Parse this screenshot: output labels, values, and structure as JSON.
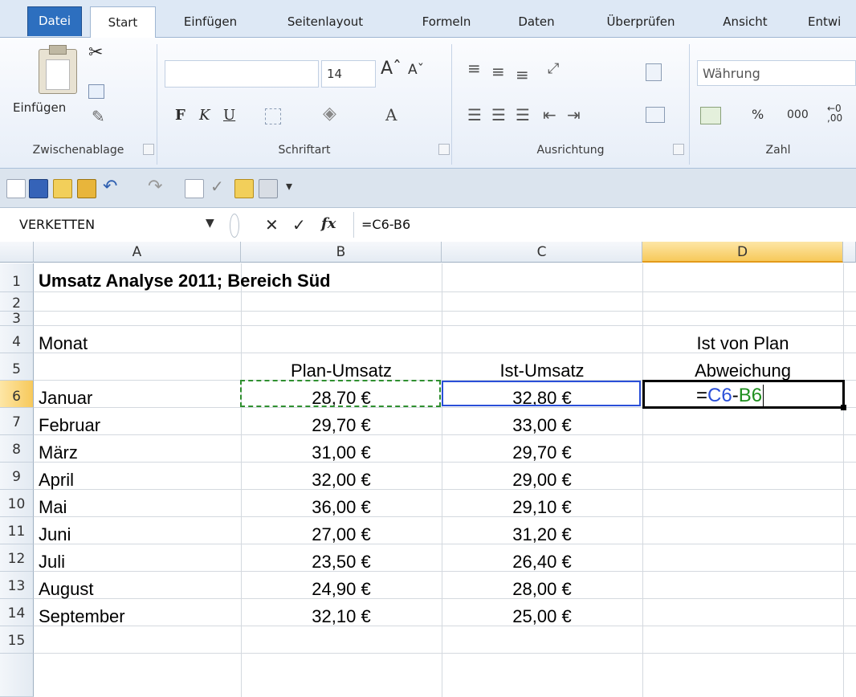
{
  "ribbon_tabs": [
    "Datei",
    "Start",
    "Einfügen",
    "Seitenlayout",
    "Formeln",
    "Daten",
    "Überprüfen",
    "Ansicht",
    "Entwi"
  ],
  "ribbon": {
    "paste_label": "Einfügen",
    "font_size": "14",
    "bold": "F",
    "italic": "K",
    "underline": "U",
    "number_format": "Währung",
    "percent": "%",
    "thousands": "000",
    "groups": [
      "Zwischenablage",
      "Schriftart",
      "Ausrichtung",
      "Zahl"
    ]
  },
  "formula_bar": {
    "name_box": "VERKETTEN",
    "cancel": "✕",
    "enter": "✓",
    "fx": "fx",
    "formula": "=C6-B6"
  },
  "columns": [
    "A",
    "B",
    "C",
    "D"
  ],
  "rows": [
    "1",
    "2",
    "3",
    "4",
    "5",
    "6",
    "7",
    "8",
    "9",
    "10",
    "11",
    "12",
    "13",
    "14",
    "15"
  ],
  "title": "Umsatz Analyse 2011; Bereich Süd",
  "header": {
    "monat": "Monat",
    "plan": "Plan-Umsatz",
    "ist": "Ist-Umsatz",
    "abw1": "Ist von Plan",
    "abw2": "Abweichung"
  },
  "edit_cell": {
    "eq": "=",
    "ref1": "C6",
    "op": "-",
    "ref2": "B6"
  },
  "data_rows": [
    {
      "month": "Januar",
      "plan": "28,70 €",
      "ist": "32,80 €"
    },
    {
      "month": "Februar",
      "plan": "29,70 €",
      "ist": "33,00 €"
    },
    {
      "month": "März",
      "plan": "31,00 €",
      "ist": "29,70 €"
    },
    {
      "month": "April",
      "plan": "32,00 €",
      "ist": "29,00 €"
    },
    {
      "month": "Mai",
      "plan": "36,00 €",
      "ist": "29,10 €"
    },
    {
      "month": "Juni",
      "plan": "27,00 €",
      "ist": "31,20 €"
    },
    {
      "month": "Juli",
      "plan": "23,50 €",
      "ist": "26,40 €"
    },
    {
      "month": "August",
      "plan": "24,90 €",
      "ist": "28,00 €"
    },
    {
      "month": "September",
      "plan": "32,10 €",
      "ist": "25,00 €"
    }
  ]
}
